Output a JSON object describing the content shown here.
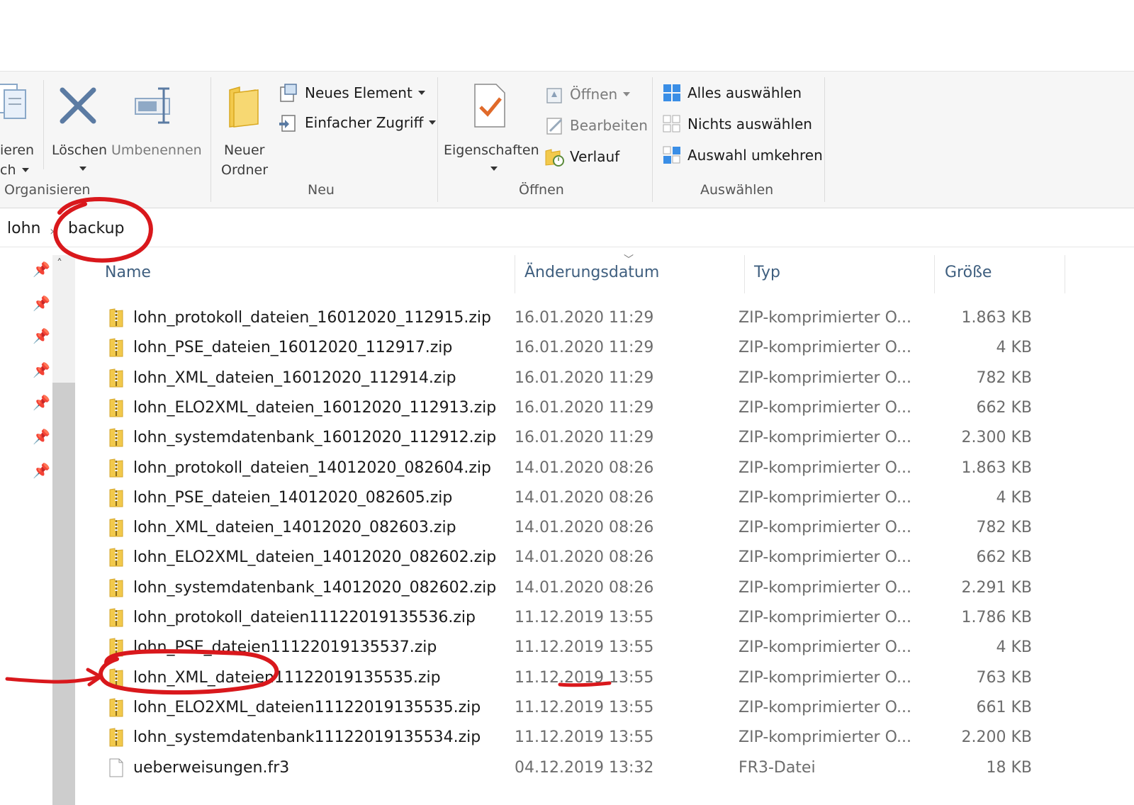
{
  "ribbon": {
    "organize": {
      "copy_label_partial": "ieren",
      "copy_label_partial2": "ch",
      "delete_label": "Löschen",
      "rename_label": "Umbenennen",
      "group_label": "Organisieren"
    },
    "new": {
      "new_folder_line1": "Neuer",
      "new_folder_line2": "Ordner",
      "new_item_label": "Neues Element",
      "easy_access_label": "Einfacher Zugriff",
      "group_label": "Neu"
    },
    "open": {
      "properties_label": "Eigenschaften",
      "open_label": "Öffnen",
      "edit_label": "Bearbeiten",
      "history_label": "Verlauf",
      "group_label": "Öffnen"
    },
    "select": {
      "select_all_label": "Alles auswählen",
      "select_none_label": "Nichts auswählen",
      "invert_label": "Auswahl umkehren",
      "group_label": "Auswählen"
    }
  },
  "address": {
    "crumbs": [
      "lohn",
      "backup"
    ]
  },
  "columns": {
    "name": "Name",
    "date": "Änderungsdatum",
    "type": "Typ",
    "size": "Größe"
  },
  "files": [
    {
      "name": "lohn_protokoll_dateien_16012020_112915.zip",
      "date": "16.01.2020 11:29",
      "type": "ZIP-komprimierter O...",
      "size": "1.863 KB"
    },
    {
      "name": "lohn_PSE_dateien_16012020_112917.zip",
      "date": "16.01.2020 11:29",
      "type": "ZIP-komprimierter O...",
      "size": "4 KB"
    },
    {
      "name": "lohn_XML_dateien_16012020_112914.zip",
      "date": "16.01.2020 11:29",
      "type": "ZIP-komprimierter O...",
      "size": "782 KB"
    },
    {
      "name": "lohn_ELO2XML_dateien_16012020_112913.zip",
      "date": "16.01.2020 11:29",
      "type": "ZIP-komprimierter O...",
      "size": "662 KB"
    },
    {
      "name": "lohn_systemdatenbank_16012020_112912.zip",
      "date": "16.01.2020 11:29",
      "type": "ZIP-komprimierter O...",
      "size": "2.300 KB"
    },
    {
      "name": "lohn_protokoll_dateien_14012020_082604.zip",
      "date": "14.01.2020 08:26",
      "type": "ZIP-komprimierter O...",
      "size": "1.863 KB"
    },
    {
      "name": "lohn_PSE_dateien_14012020_082605.zip",
      "date": "14.01.2020 08:26",
      "type": "ZIP-komprimierter O...",
      "size": "4 KB"
    },
    {
      "name": "lohn_XML_dateien_14012020_082603.zip",
      "date": "14.01.2020 08:26",
      "type": "ZIP-komprimierter O...",
      "size": "782 KB"
    },
    {
      "name": "lohn_ELO2XML_dateien_14012020_082602.zip",
      "date": "14.01.2020 08:26",
      "type": "ZIP-komprimierter O...",
      "size": "662 KB"
    },
    {
      "name": "lohn_systemdatenbank_14012020_082602.zip",
      "date": "14.01.2020 08:26",
      "type": "ZIP-komprimierter O...",
      "size": "2.291 KB"
    },
    {
      "name": "lohn_protokoll_dateien11122019135536.zip",
      "date": "11.12.2019 13:55",
      "type": "ZIP-komprimierter O...",
      "size": "1.786 KB"
    },
    {
      "name": "lohn_PSE_dateien11122019135537.zip",
      "date": "11.12.2019 13:55",
      "type": "ZIP-komprimierter O...",
      "size": "4 KB"
    },
    {
      "name": "lohn_XML_dateien11122019135535.zip",
      "date": "11.12.2019 13:55",
      "type": "ZIP-komprimierter O...",
      "size": "763 KB"
    },
    {
      "name": "lohn_ELO2XML_dateien11122019135535.zip",
      "date": "11.12.2019 13:55",
      "type": "ZIP-komprimierter O...",
      "size": "661 KB"
    },
    {
      "name": "lohn_systemdatenbank11122019135534.zip",
      "date": "11.12.2019 13:55",
      "type": "ZIP-komprimierter O...",
      "size": "2.200 KB"
    },
    {
      "name": "ueberweisungen.fr3",
      "date": "04.12.2019 13:32",
      "type": "FR3-Datei",
      "size": "18 KB"
    }
  ],
  "colors": {
    "annotation": "#d9181c",
    "zip_folder": "#f2c94c",
    "header_text": "#3f5f7f"
  }
}
